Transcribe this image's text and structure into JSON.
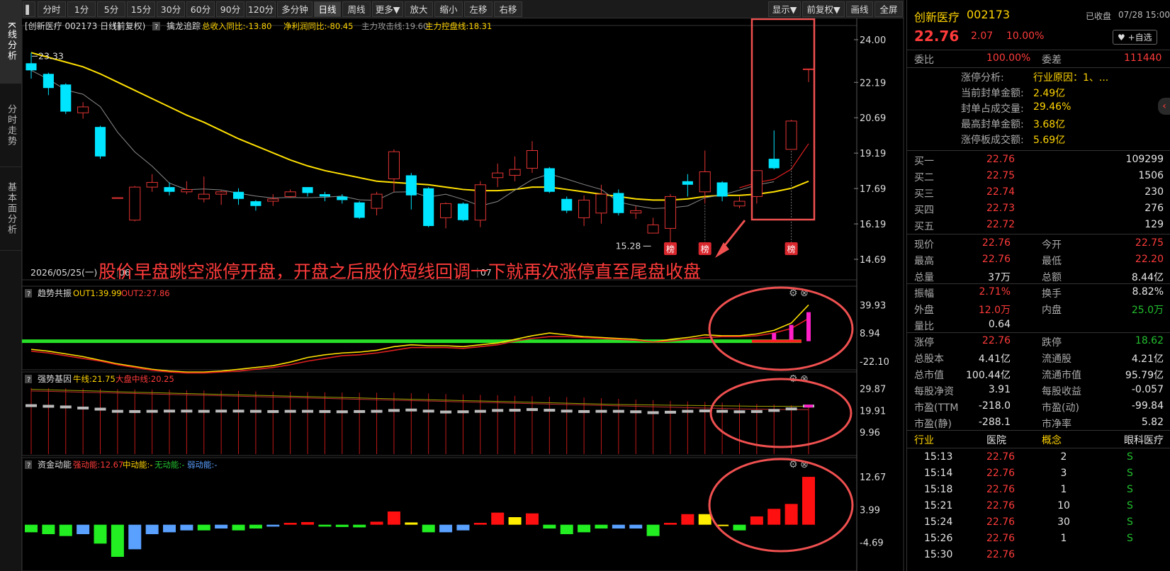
{
  "side_tabs": [
    "K线分析",
    "分时走势",
    "基本面分析"
  ],
  "toolbar": {
    "buttons": [
      "分时",
      "1分",
      "5分",
      "15分",
      "30分",
      "60分",
      "90分",
      "120分",
      "多分钟",
      "日线",
      "周线",
      "更多▼",
      "放大",
      "缩小",
      "左移",
      "右移"
    ],
    "right_buttons": [
      "显示▼",
      "前复权▼",
      "画线",
      "全屏"
    ]
  },
  "main_chart": {
    "legend": {
      "stock": "[创新医疗 002173 日线]",
      "adjust": "(前复权)",
      "help": "?",
      "indicator": "擒龙追踪",
      "items": [
        {
          "label": "总收入同比:-13.80",
          "color": "#ffd400"
        },
        {
          "label": "净利润同比:-80.45",
          "color": "#ffd400"
        },
        {
          "label": "主力攻击线:19.60",
          "color": "#9a9a9a"
        },
        {
          "label": "主力控盘线:18.31",
          "color": "#ffd400"
        }
      ]
    },
    "y_ticks": [
      "24.00",
      "22.19",
      "20.69",
      "19.19",
      "17.69",
      "16.19",
      "14.69"
    ],
    "high_label": "23.33",
    "low_label": "15.28",
    "date_label": "2026/05/25(一)",
    "month_labels": [
      "06",
      "07"
    ],
    "bang": "榜",
    "annotation": "股价早盘跳空涨停开盘，开盘之后股价短线回调一下就再次涨停直至尾盘收盘"
  },
  "chart_data": {
    "type": "candlestick",
    "ylim": [
      14.69,
      24.0
    ],
    "candles": [
      {
        "o": 23.0,
        "c": 22.7,
        "h": 23.45,
        "l": 22.35
      },
      {
        "o": 22.55,
        "c": 21.95,
        "h": 22.6,
        "l": 21.65
      },
      {
        "o": 22.1,
        "c": 20.95,
        "h": 22.15,
        "l": 20.85
      },
      {
        "o": 20.9,
        "c": 21.15,
        "h": 21.35,
        "l": 20.65
      },
      {
        "o": 20.3,
        "c": 19.05,
        "h": 20.35,
        "l": 18.95
      },
      {
        "o": 17.3,
        "c": 17.3,
        "h": 17.3,
        "l": 17.3
      },
      {
        "o": 16.35,
        "c": 17.75,
        "h": 17.8,
        "l": 16.3
      },
      {
        "o": 17.75,
        "c": 17.95,
        "h": 18.3,
        "l": 17.55
      },
      {
        "o": 17.75,
        "c": 17.55,
        "h": 17.95,
        "l": 17.4
      },
      {
        "o": 17.55,
        "c": 17.65,
        "h": 18.0,
        "l": 17.45
      },
      {
        "o": 17.25,
        "c": 17.45,
        "h": 18.2,
        "l": 17.1
      },
      {
        "o": 17.45,
        "c": 17.55,
        "h": 17.6,
        "l": 17.0
      },
      {
        "o": 17.55,
        "c": 17.25,
        "h": 17.7,
        "l": 17.0
      },
      {
        "o": 17.15,
        "c": 16.95,
        "h": 17.2,
        "l": 16.75
      },
      {
        "o": 17.15,
        "c": 17.25,
        "h": 17.45,
        "l": 16.95
      },
      {
        "o": 17.35,
        "c": 17.55,
        "h": 17.65,
        "l": 17.3
      },
      {
        "o": 17.75,
        "c": 17.5,
        "h": 17.75,
        "l": 17.35
      },
      {
        "o": 17.45,
        "c": 17.35,
        "h": 17.55,
        "l": 17.15
      },
      {
        "o": 17.35,
        "c": 17.2,
        "h": 17.45,
        "l": 17.05
      },
      {
        "o": 17.1,
        "c": 16.45,
        "h": 17.15,
        "l": 16.4
      },
      {
        "o": 16.85,
        "c": 17.45,
        "h": 17.55,
        "l": 16.55
      },
      {
        "o": 18.1,
        "c": 19.25,
        "h": 19.35,
        "l": 17.55
      },
      {
        "o": 18.25,
        "c": 17.4,
        "h": 18.35,
        "l": 16.8
      },
      {
        "o": 17.7,
        "c": 16.1,
        "h": 17.75,
        "l": 16.05
      },
      {
        "o": 16.45,
        "c": 17.05,
        "h": 17.1,
        "l": 16.0
      },
      {
        "o": 17.05,
        "c": 16.35,
        "h": 17.1,
        "l": 16.3
      },
      {
        "o": 16.35,
        "c": 17.85,
        "h": 18.0,
        "l": 16.05
      },
      {
        "o": 18.15,
        "c": 18.35,
        "h": 18.75,
        "l": 17.75
      },
      {
        "o": 18.25,
        "c": 18.5,
        "h": 19.05,
        "l": 18.0
      },
      {
        "o": 18.55,
        "c": 19.3,
        "h": 19.7,
        "l": 18.35
      },
      {
        "o": 18.55,
        "c": 17.55,
        "h": 18.6,
        "l": 17.5
      },
      {
        "o": 17.25,
        "c": 16.75,
        "h": 17.35,
        "l": 16.65
      },
      {
        "o": 16.45,
        "c": 17.2,
        "h": 17.4,
        "l": 16.1
      },
      {
        "o": 16.65,
        "c": 17.45,
        "h": 17.85,
        "l": 16.2
      },
      {
        "o": 17.5,
        "c": 16.65,
        "h": 17.65,
        "l": 16.55
      },
      {
        "o": 16.65,
        "c": 16.75,
        "h": 16.95,
        "l": 16.4
      },
      {
        "o": 15.8,
        "c": 16.15,
        "h": 16.45,
        "l": 15.8
      },
      {
        "o": 16.0,
        "c": 17.35,
        "h": 17.45,
        "l": 15.35
      },
      {
        "o": 18.0,
        "c": 17.85,
        "h": 18.3,
        "l": 17.35
      },
      {
        "o": 17.55,
        "c": 18.4,
        "h": 19.3,
        "l": 17.05
      },
      {
        "o": 17.95,
        "c": 17.35,
        "h": 18.0,
        "l": 17.15
      },
      {
        "o": 16.95,
        "c": 17.15,
        "h": 17.35,
        "l": 16.85
      },
      {
        "o": 17.35,
        "c": 18.45,
        "h": 18.45,
        "l": 17.05
      },
      {
        "o": 18.95,
        "c": 18.55,
        "h": 20.15,
        "l": 18.5
      },
      {
        "o": 19.35,
        "c": 20.55,
        "h": 20.6,
        "l": 19.35
      },
      {
        "o": 22.75,
        "c": 22.76,
        "h": 22.76,
        "l": 22.2
      }
    ],
    "bang_index": [
      37,
      39,
      44
    ]
  },
  "ind1": {
    "help": "?",
    "name": "趋势共振",
    "out1": "OUT1:39.99",
    "out2": "OUT2:27.86",
    "y_ticks": [
      "39.93",
      "8.94",
      "-22.10"
    ],
    "series1": [
      -9,
      -11,
      -14,
      -17,
      -21,
      -25,
      -28,
      -31,
      -33,
      -34,
      -34,
      -33,
      -31,
      -29,
      -27,
      -23,
      -18,
      -15,
      -13,
      -12,
      -10,
      -6,
      -4,
      -5,
      -5,
      -6,
      -4,
      -2,
      2,
      6,
      9,
      7,
      5,
      4,
      3,
      2,
      -1,
      2,
      4,
      7,
      6,
      6,
      8,
      12,
      20,
      40
    ],
    "series2": [
      -11,
      -13,
      -16,
      -19,
      -22,
      -26,
      -29,
      -32,
      -34,
      -35,
      -35,
      -34,
      -33,
      -31,
      -29,
      -26,
      -22,
      -19,
      -16,
      -15,
      -13,
      -10,
      -7,
      -7,
      -7,
      -8,
      -6,
      -4,
      0,
      3,
      5,
      5,
      4,
      3,
      2,
      1,
      -1,
      0,
      2,
      4,
      5,
      5,
      6,
      9,
      14,
      25
    ],
    "bars": [
      0,
      0,
      0,
      0,
      0,
      0,
      0,
      0,
      0,
      0,
      0,
      0,
      0,
      0,
      0,
      0,
      0,
      0,
      0,
      0,
      0,
      0,
      0,
      0,
      0,
      0,
      0,
      0,
      0,
      0,
      0,
      0,
      0,
      0,
      0,
      0,
      0,
      0,
      0,
      0,
      0,
      0,
      0,
      9,
      18,
      32
    ]
  },
  "ind2": {
    "help": "?",
    "name": "强势基因",
    "niu": "牛线:21.75",
    "dapan": "大盘中线:20.25",
    "y_ticks": [
      "29.87",
      "19.91",
      "9.96"
    ],
    "grey": [
      22.1,
      21.8,
      21.5,
      21.0,
      20.5,
      19.5,
      19.4,
      19.5,
      19.6,
      19.6,
      19.5,
      19.6,
      19.6,
      19.5,
      19.4,
      19.5,
      19.5,
      19.4,
      19.3,
      19.4,
      19.5,
      19.9,
      20.1,
      19.6,
      19.2,
      19.3,
      19.5,
      19.9,
      20.0,
      20.3,
      20.0,
      19.6,
      19.4,
      19.5,
      19.5,
      19.3,
      18.9,
      19.1,
      19.5,
      19.7,
      19.5,
      19.3,
      19.4,
      19.9,
      20.6,
      21.9
    ],
    "thin_top": [
      30.2,
      30.1,
      30.0,
      29.9,
      29.8,
      29.6,
      29.5,
      29.4,
      29.3,
      29.1,
      29.0,
      28.9,
      28.8,
      28.6,
      28.5,
      28.4,
      28.3,
      28.2,
      28.1,
      28.0,
      28.0,
      28.0,
      27.8,
      27.6,
      27.4,
      27.2,
      27.0,
      26.8,
      26.6,
      26.4,
      26.2,
      26.0,
      25.8,
      25.5,
      25.2,
      24.9,
      24.6,
      24.3,
      24.0,
      23.8,
      23.5,
      23.2,
      22.9,
      22.6,
      22.3,
      22.0
    ],
    "niu_line": [
      29.5,
      29.3,
      29.1,
      28.9,
      28.7,
      28.4,
      28.2,
      28.0,
      27.8,
      27.6,
      27.4,
      27.2,
      27.0,
      26.8,
      26.6,
      26.4,
      26.2,
      26.0,
      25.8,
      25.6,
      25.4,
      25.2,
      25.0,
      24.8,
      24.6,
      24.4,
      24.2,
      24.0,
      23.8,
      23.6,
      23.4,
      23.2,
      23.0,
      22.8,
      22.6,
      22.5,
      22.4,
      22.3,
      22.2,
      22.1,
      22.0,
      21.9,
      21.8,
      21.8,
      21.8,
      21.75
    ],
    "dapan_line": [
      28.8,
      28.6,
      28.4,
      28.2,
      28.0,
      27.8,
      27.6,
      27.4,
      27.2,
      27.0,
      26.8,
      26.6,
      26.4,
      26.2,
      26.0,
      25.8,
      25.6,
      25.4,
      25.2,
      25.0,
      24.8,
      24.6,
      24.4,
      24.2,
      24.0,
      23.8,
      23.6,
      23.4,
      23.2,
      23.0,
      22.8,
      22.6,
      22.4,
      22.2,
      22.0,
      21.8,
      21.6,
      21.4,
      21.2,
      21.0,
      20.8,
      20.6,
      20.5,
      20.4,
      20.3,
      20.25
    ]
  },
  "ind3": {
    "help": "?",
    "name": "资金动能",
    "strong": "强动能:12.67",
    "mid": "中动能:-",
    "none": "无动能:-",
    "weak": "弱动能:-",
    "y_ticks": [
      "12.67",
      "3.99",
      "-4.69"
    ],
    "bars": [
      [
        -2,
        "g"
      ],
      [
        -2.5,
        "g"
      ],
      [
        -3,
        "g"
      ],
      [
        -2.5,
        "b"
      ],
      [
        -5,
        "g"
      ],
      [
        -8.5,
        "g"
      ],
      [
        -6.5,
        "b"
      ],
      [
        -2.5,
        "b"
      ],
      [
        -2,
        "b"
      ],
      [
        -1.5,
        "b"
      ],
      [
        -1.5,
        "g"
      ],
      [
        -1,
        "b"
      ],
      [
        -1.5,
        "g"
      ],
      [
        -1,
        "g"
      ],
      [
        -0.5,
        "b"
      ],
      [
        0.5,
        "r"
      ],
      [
        0.7,
        "r"
      ],
      [
        -0.5,
        "g"
      ],
      [
        -0.6,
        "g"
      ],
      [
        -0.7,
        "g"
      ],
      [
        0.8,
        "r"
      ],
      [
        3.5,
        "r"
      ],
      [
        0.6,
        "y"
      ],
      [
        -2,
        "g"
      ],
      [
        -2,
        "b"
      ],
      [
        -1.5,
        "b"
      ],
      [
        0.5,
        "r"
      ],
      [
        3.2,
        "r"
      ],
      [
        2,
        "y"
      ],
      [
        3,
        "r"
      ],
      [
        -1,
        "g"
      ],
      [
        -2.5,
        "g"
      ],
      [
        -2,
        "g"
      ],
      [
        -1,
        "g"
      ],
      [
        -1,
        "b"
      ],
      [
        -1,
        "b"
      ],
      [
        -3,
        "g"
      ],
      [
        0.5,
        "r"
      ],
      [
        2.8,
        "r"
      ],
      [
        2.8,
        "y"
      ],
      [
        -0.2,
        "y"
      ],
      [
        -1.5,
        "g"
      ],
      [
        2.2,
        "r"
      ],
      [
        4.2,
        "r"
      ],
      [
        5.5,
        "r"
      ],
      [
        12.67,
        "r"
      ]
    ]
  },
  "right": {
    "name": "创新医疗",
    "code": "002173",
    "status": "已收盘",
    "time": "07/28 15:00",
    "price": "22.76",
    "change": "2.07",
    "pct": "10.00%",
    "watch": "♥ +自选",
    "weibi_l": "委比",
    "weibi_v": "100.00%",
    "weicha_l": "委差",
    "weicha_v": "111440",
    "limit": [
      {
        "l": "涨停分析:",
        "v": "行业原因：1、..."
      },
      {
        "l": "当前封单金额:",
        "v": "2.49亿"
      },
      {
        "l": "封单占成交量:",
        "v": "29.46%"
      },
      {
        "l": "最高封单金额:",
        "v": "3.68亿"
      },
      {
        "l": "涨停板成交额:",
        "v": "5.69亿"
      }
    ],
    "buys": [
      {
        "l": "买一",
        "p": "22.76",
        "v": "109299"
      },
      {
        "l": "买二",
        "p": "22.75",
        "v": "1506"
      },
      {
        "l": "买三",
        "p": "22.74",
        "v": "230"
      },
      {
        "l": "买四",
        "p": "22.73",
        "v": "276"
      },
      {
        "l": "买五",
        "p": "22.72",
        "v": "129"
      }
    ],
    "stats": [
      [
        {
          "l": "现价",
          "v": "22.76",
          "c": "red"
        },
        {
          "l": "今开",
          "v": "22.75",
          "c": "red"
        }
      ],
      [
        {
          "l": "最高",
          "v": "22.76",
          "c": "red"
        },
        {
          "l": "最低",
          "v": "22.20",
          "c": "red"
        }
      ],
      [
        {
          "l": "总量",
          "v": "37万",
          "c": "white"
        },
        {
          "l": "总额",
          "v": "8.44亿",
          "c": "white"
        }
      ],
      [
        {
          "l": "振幅",
          "v": "2.71%",
          "c": "red"
        },
        {
          "l": "换手",
          "v": "8.82%",
          "c": "white"
        }
      ],
      [
        {
          "l": "外盘",
          "v": "12.0万",
          "c": "red"
        },
        {
          "l": "内盘",
          "v": "25.0万",
          "c": "green"
        }
      ],
      [
        {
          "l": "量比",
          "v": "0.64",
          "c": "white"
        },
        {
          "l": "",
          "v": "",
          "c": "white"
        }
      ],
      [
        {
          "l": "涨停",
          "v": "22.76",
          "c": "red"
        },
        {
          "l": "跌停",
          "v": "18.62",
          "c": "green"
        }
      ],
      [
        {
          "l": "总股本",
          "v": "4.41亿",
          "c": "white"
        },
        {
          "l": "流通股",
          "v": "4.21亿",
          "c": "white"
        }
      ],
      [
        {
          "l": "总市值",
          "v": "100.44亿",
          "c": "white"
        },
        {
          "l": "流通市值",
          "v": "95.79亿",
          "c": "white"
        }
      ],
      [
        {
          "l": "每股净资",
          "v": "3.91",
          "c": "white"
        },
        {
          "l": "每股收益",
          "v": "-0.057",
          "c": "white"
        }
      ],
      [
        {
          "l": "市盈(TTM",
          "v": "-218.0",
          "c": "white"
        },
        {
          "l": "市盈(动)",
          "v": "-99.84",
          "c": "white"
        }
      ],
      [
        {
          "l": "市盈(静)",
          "v": "-288.1",
          "c": "white"
        },
        {
          "l": "市净率",
          "v": "5.82",
          "c": "white"
        }
      ]
    ],
    "industry": {
      "l1": "行业",
      "v1": "医院",
      "l2": "概念",
      "v2": "眼科医疗"
    },
    "ticks": [
      {
        "t": "15:13",
        "p": "22.76",
        "v": "2",
        "s": "S"
      },
      {
        "t": "15:14",
        "p": "22.76",
        "v": "3",
        "s": "S"
      },
      {
        "t": "15:18",
        "p": "22.76",
        "v": "1",
        "s": "S"
      },
      {
        "t": "15:21",
        "p": "22.76",
        "v": "10",
        "s": "S"
      },
      {
        "t": "15:24",
        "p": "22.76",
        "v": "30",
        "s": "S"
      },
      {
        "t": "15:26",
        "p": "22.76",
        "v": "1",
        "s": "S"
      },
      {
        "t": "15:30",
        "p": "22.76",
        "v": "",
        "s": ""
      }
    ]
  }
}
